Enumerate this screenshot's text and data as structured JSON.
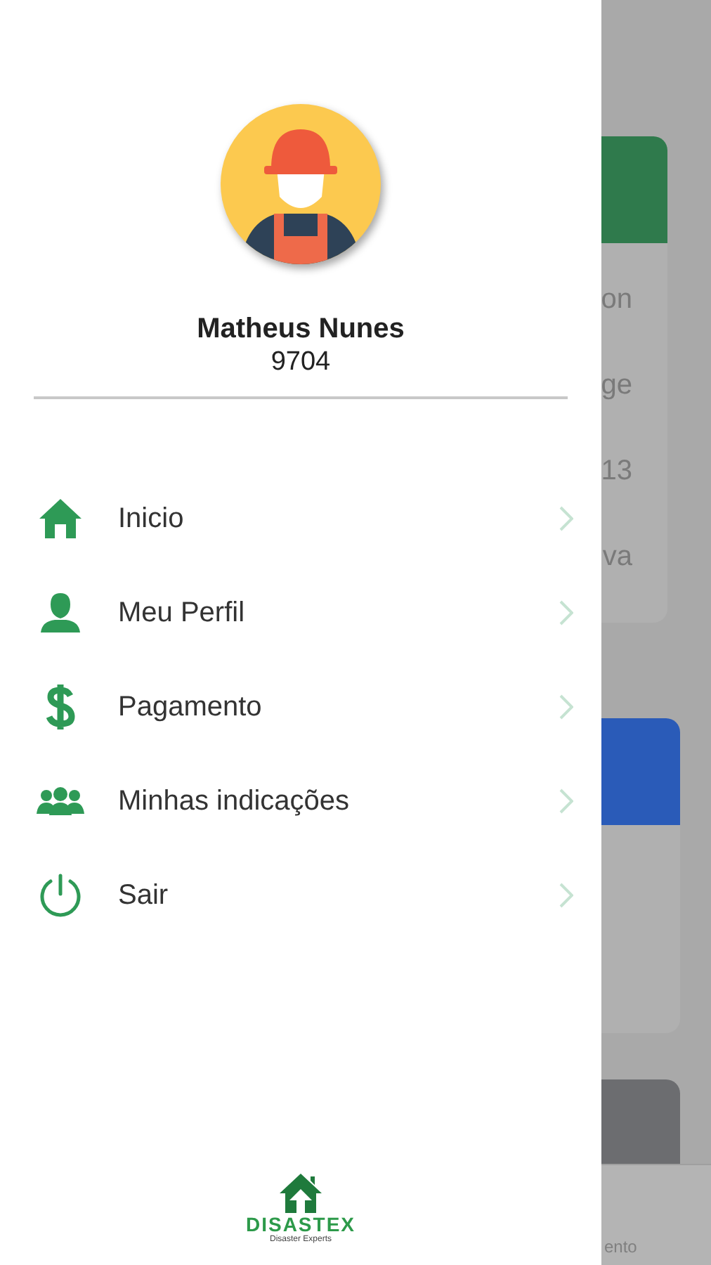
{
  "drawer": {
    "profile": {
      "name": "Matheus Nunes",
      "code": "9704"
    },
    "menu": [
      {
        "kind": "home",
        "label": "Inicio"
      },
      {
        "kind": "profile",
        "label": "Meu Perfil"
      },
      {
        "kind": "payment",
        "label": "Pagamento"
      },
      {
        "kind": "referrals",
        "label": "Minhas indicações"
      },
      {
        "kind": "logout",
        "label": "Sair"
      }
    ],
    "logo": {
      "name": "DISASTEX",
      "tagline": "Disaster Experts"
    }
  },
  "background": {
    "card_lines": [
      "on",
      "ge",
      "13",
      "va"
    ],
    "tab_label": "ento"
  }
}
